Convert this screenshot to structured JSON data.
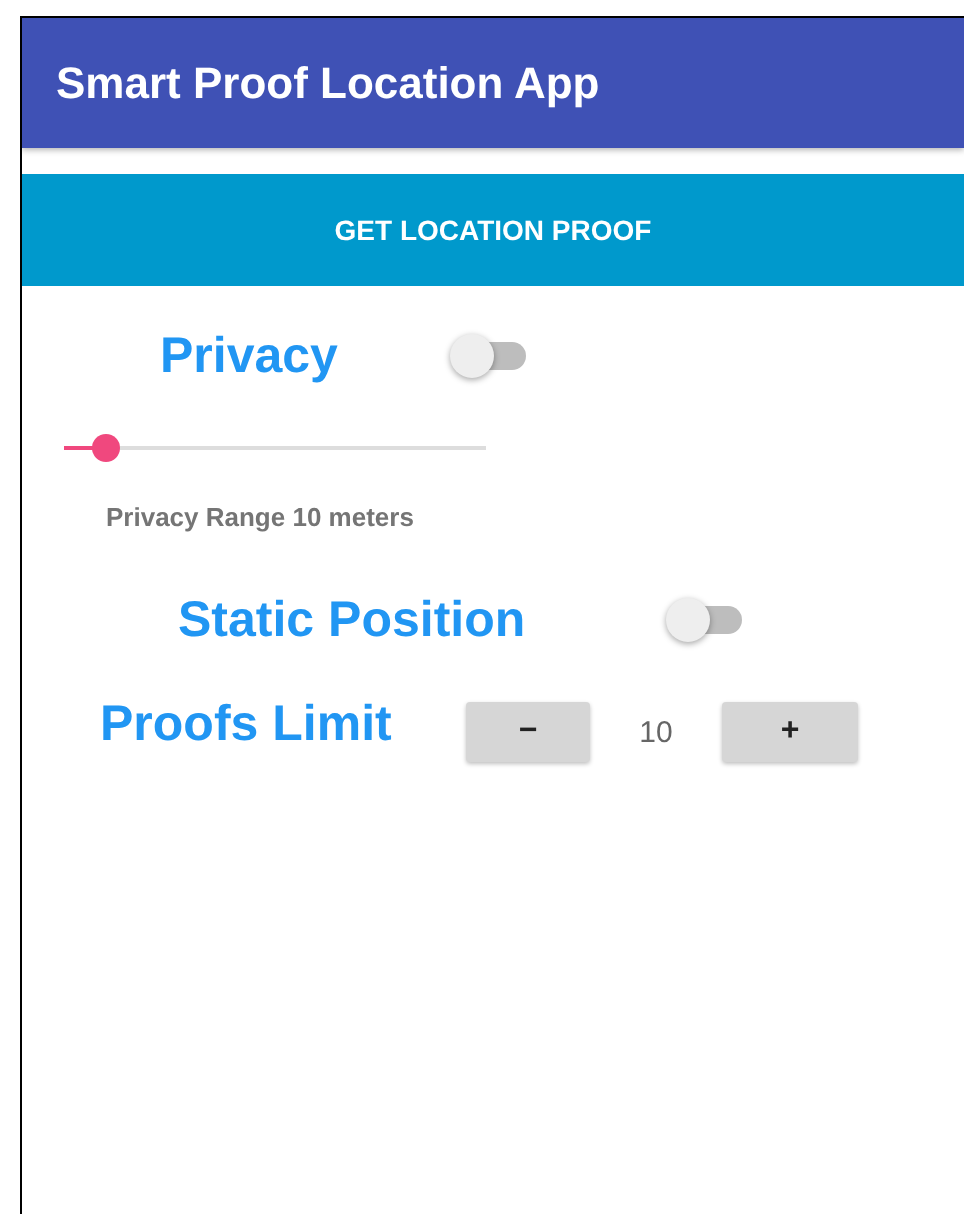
{
  "app_bar": {
    "title": "Smart Proof Location App"
  },
  "action_button": {
    "label": "GET LOCATION PROOF"
  },
  "privacy": {
    "label": "Privacy",
    "on": false
  },
  "privacy_range": {
    "level": 0.1,
    "caption": "Privacy Range 10 meters"
  },
  "static_position": {
    "label": "Static Position",
    "on": false
  },
  "proofs_limit": {
    "label": "Proofs Limit",
    "decrement": "−",
    "value": "10",
    "increment": "+"
  }
}
